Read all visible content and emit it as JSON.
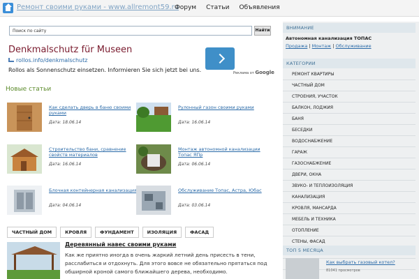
{
  "topbar": {
    "site_title": "Ремонт своими руками - www.allremont59.ru",
    "nav": [
      "Форум",
      "Статьи",
      "Объявления"
    ]
  },
  "search": {
    "value": "Поиск по сайту",
    "button_label": "Найти"
  },
  "ad": {
    "headline": "Denkmalschutz für Museen",
    "url": "rollos.info/denkmalschutz",
    "text": "Rollos als Sonnenschutz einsetzen. Informieren Sie sich jetzt bei uns.",
    "attribution_prefix": "Реклама от",
    "attribution_brand": "Google"
  },
  "new_articles": {
    "title": "Новые статьи",
    "items": [
      {
        "title": "Как сделать дверь в баню своими руками",
        "date": "Дата: 18.06.14"
      },
      {
        "title": "Рулонный газон своими руками",
        "date": "Дата: 16.06.14"
      },
      {
        "title": "Строительство бани, сравнение свойств материалов",
        "date": "Дата: 16.06.14"
      },
      {
        "title": "Монтаж автономной канализации Топас ЯПр",
        "date": "Дата: 06.06.14"
      },
      {
        "title": "Блочная контейнерная канализация",
        "date": "Дата: 04.06.14"
      },
      {
        "title": "Обслуживание Топас, Астра, Юбас",
        "date": "Дата: 03.06.14"
      }
    ]
  },
  "tags": [
    "ЧАСТНЫЙ ДОМ",
    "КРОВЛЯ",
    "ФУНДАМЕНТ",
    "ИЗОЛЯЦИЯ",
    "ФАСАД"
  ],
  "featured": {
    "title": "Деревянный навес своими руками",
    "text": "Как же приятно иногда в очень жаркий летний день присесть в тени, расслабиться и отдохнуть. Для этого вовсе не обязательно прятаться под обширной кроной самого ближайшего дерева, необходимо."
  },
  "sidebar": {
    "notice_title": "ВНИМАНИЕ",
    "notice_bold": "Автономная канализация ТОПАС",
    "notice_links": [
      "Продажа",
      "Монтаж",
      "Обслуживание"
    ],
    "notice_sep": "|",
    "categories_title": "КАТЕГОРИИ",
    "categories": [
      "РЕМОНТ КВАРТИРЫ",
      "ЧАСТНЫЙ ДОМ",
      "СТРОЕНИЯ, УЧАСТОК",
      "БАЛКОН, ЛОДЖИЯ",
      "БАНЯ",
      "БЕСЕДКИ",
      "ВОДОСНАБЖЕНИЕ",
      "ГАРАЖ",
      "ГАЗОСНАБЖЕНИЕ",
      "ДВЕРИ, ОКНА",
      "ЗВУКО- И ТЕПЛОИЗОЛЯЦИЯ",
      "КАНАЛИЗАЦИЯ",
      "КРОВЛЯ, МАНСАРДА",
      "МЕБЕЛЬ И ТЕХНИКА",
      "ОТОПЛЕНИЕ",
      "СТЕНЫ, ФАСАД",
      "ФУНДАМЕНТ",
      "HI-TECH"
    ],
    "top_title": "ТОП 5 МЕСЯЦА",
    "top_item_title": "Как выбрать газовый котел?",
    "top_item_views": "81041 просмотров"
  }
}
